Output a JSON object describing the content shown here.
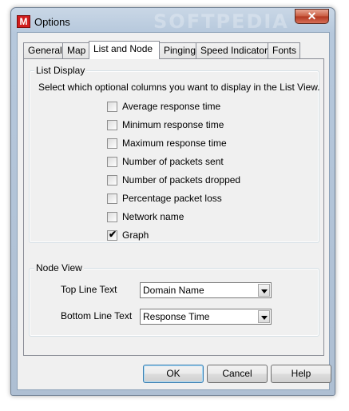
{
  "window": {
    "title": "Options",
    "app_icon_letter": "M",
    "watermark": "SOFTPEDIA",
    "close_glyph": "✕"
  },
  "tabs": [
    {
      "label": "General",
      "active": false
    },
    {
      "label": "Map",
      "active": false
    },
    {
      "label": "List and Node",
      "active": true
    },
    {
      "label": "Pinging",
      "active": false
    },
    {
      "label": "Speed Indicators",
      "active": false
    },
    {
      "label": "Fonts",
      "active": false
    }
  ],
  "list_display": {
    "title": "List Display",
    "instruction": "Select which optional columns you want to display in the List View.",
    "options": [
      {
        "label": "Average response time",
        "checked": false
      },
      {
        "label": "Minimum response time",
        "checked": false
      },
      {
        "label": "Maximum response time",
        "checked": false
      },
      {
        "label": "Number of packets sent",
        "checked": false
      },
      {
        "label": "Number of packets dropped",
        "checked": false
      },
      {
        "label": "Percentage packet loss",
        "checked": false
      },
      {
        "label": "Network name",
        "checked": false
      },
      {
        "label": "Graph",
        "checked": true
      }
    ]
  },
  "node_view": {
    "title": "Node View",
    "top_line_label": "Top Line Text",
    "top_line_value": "Domain Name",
    "bottom_line_label": "Bottom Line Text",
    "bottom_line_value": "Response Time"
  },
  "buttons": {
    "ok": "OK",
    "cancel": "Cancel",
    "help": "Help"
  },
  "check_glyph": "✔"
}
